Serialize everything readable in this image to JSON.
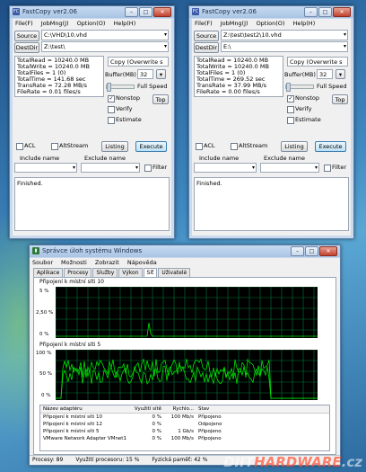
{
  "copy_left": {
    "title": "FastCopy ver2.06",
    "menu": [
      "File(F)",
      "JobMng(J)",
      "Option(O)",
      "Help(H)"
    ],
    "source_label": "Source",
    "source_value": "C:\\VHD\\10.vhd",
    "destdir_label": "DestDir",
    "destdir_value": "Z:\\test\\",
    "stats": [
      "TotalRead  = 10240.0 MB",
      "TotalWrite = 10240.0 MB",
      "TotalFiles = 1 (0)",
      "TotalTime  = 141.68 sec",
      "TransRate  = 72.28 MB/s",
      "FileRate   = 0.01 files/s"
    ],
    "mode": "Copy (Overwrite s",
    "buffer_label": "Buffer(MB)",
    "buffer_value": "32",
    "fullspeed_label": "Full Speed",
    "nonstop_label": "Nonstop",
    "top_label": "Top",
    "verify_label": "Verify",
    "estimate_label": "Estimate",
    "acl_label": "ACL",
    "altstream_label": "AltStream",
    "listing_label": "Listing",
    "execute_label": "Execute",
    "include_label": "Include name",
    "exclude_label": "Exclude name",
    "filter_label": "Filter",
    "log": "Finished."
  },
  "copy_right": {
    "title": "FastCopy ver2.06",
    "menu": [
      "File(F)",
      "JobMng(J)",
      "Option(O)",
      "Help(H)"
    ],
    "source_label": "Source",
    "source_value": "Z:\\test\\test2\\10.vhd",
    "destdir_label": "DestDir",
    "destdir_value": "E:\\",
    "stats": [
      "TotalRead  = 10240.0 MB",
      "TotalWrite = 10240.0 MB",
      "TotalFiles = 1 (0)",
      "TotalTime  = 269.52 sec",
      "TransRate  = 37.99 MB/s",
      "FileRate   = 0.00 files/s"
    ],
    "mode": "Copy (Overwrite s",
    "buffer_label": "Buffer(MB)",
    "buffer_value": "32",
    "fullspeed_label": "Full Speed",
    "nonstop_label": "Nonstop",
    "top_label": "Top",
    "verify_label": "Verify",
    "estimate_label": "Estimate",
    "acl_label": "ACL",
    "altstream_label": "AltStream",
    "listing_label": "Listing",
    "execute_label": "Execute",
    "include_label": "Include name",
    "exclude_label": "Exclude name",
    "filter_label": "Filter",
    "log": "Finished."
  },
  "taskmgr": {
    "title": "Správce úloh systému Windows",
    "menu": [
      "Soubor",
      "Možnosti",
      "Zobrazit",
      "Nápověda"
    ],
    "tabs": [
      "Aplikace",
      "Procesy",
      "Služby",
      "Výkon",
      "Síť",
      "Uživatelé"
    ],
    "active_tab": "Síť",
    "graph1_title": "Připojení k místní síti 10",
    "graph1_ticks": [
      "5 %",
      "2,50 %",
      "0 %"
    ],
    "graph2_title": "Připojení k místní síti 5",
    "graph2_ticks": [
      "100 %",
      "50 %",
      "0 %"
    ],
    "columns": [
      "Název adaptéru",
      "Využití sítě",
      "Rychlo...",
      "Stav"
    ],
    "rows": [
      [
        "Připojení k místní síti 10",
        "0 %",
        "100 Mb/s",
        "Připojeno"
      ],
      [
        "Připojení k místní síti 12",
        "0 %",
        "",
        "Odpojeno"
      ],
      [
        "Připojení k místní síti 5",
        "0 %",
        "1 Gb/s",
        "Připojeno"
      ],
      [
        "VMware Network Adapter VMnet1",
        "0 %",
        "100 Mb/s",
        "Připojeno"
      ]
    ],
    "status": [
      "Procesy: 89",
      "Využití procesoru: 15 %",
      "Fyzická paměť: 42 %"
    ]
  },
  "watermark": {
    "prefix": "DIIT",
    "brand": "HARDWARE",
    "suffix": ".cz"
  },
  "colors": {
    "graph_line": "#00e000",
    "graph_grid": "#007a3a",
    "accent": "#3c7fb1"
  }
}
